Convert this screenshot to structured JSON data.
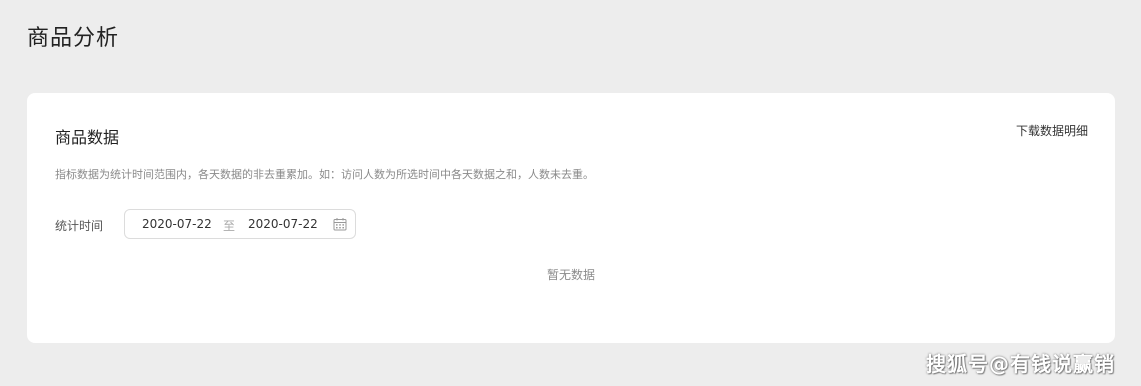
{
  "page": {
    "title": "商品分析"
  },
  "card": {
    "title": "商品数据",
    "download_label": "下载数据明细",
    "description": "指标数据为统计时间范围内，各天数据的非去重累加。如：访问人数为所选时间中各天数据之和，人数未去重。",
    "filter": {
      "label": "统计时间",
      "start_date": "2020-07-22",
      "separator": "至",
      "end_date": "2020-07-22",
      "icon": "calendar-icon"
    },
    "empty_text": "暂无数据"
  },
  "watermark": {
    "text": "搜狐号@有钱说赢销"
  }
}
